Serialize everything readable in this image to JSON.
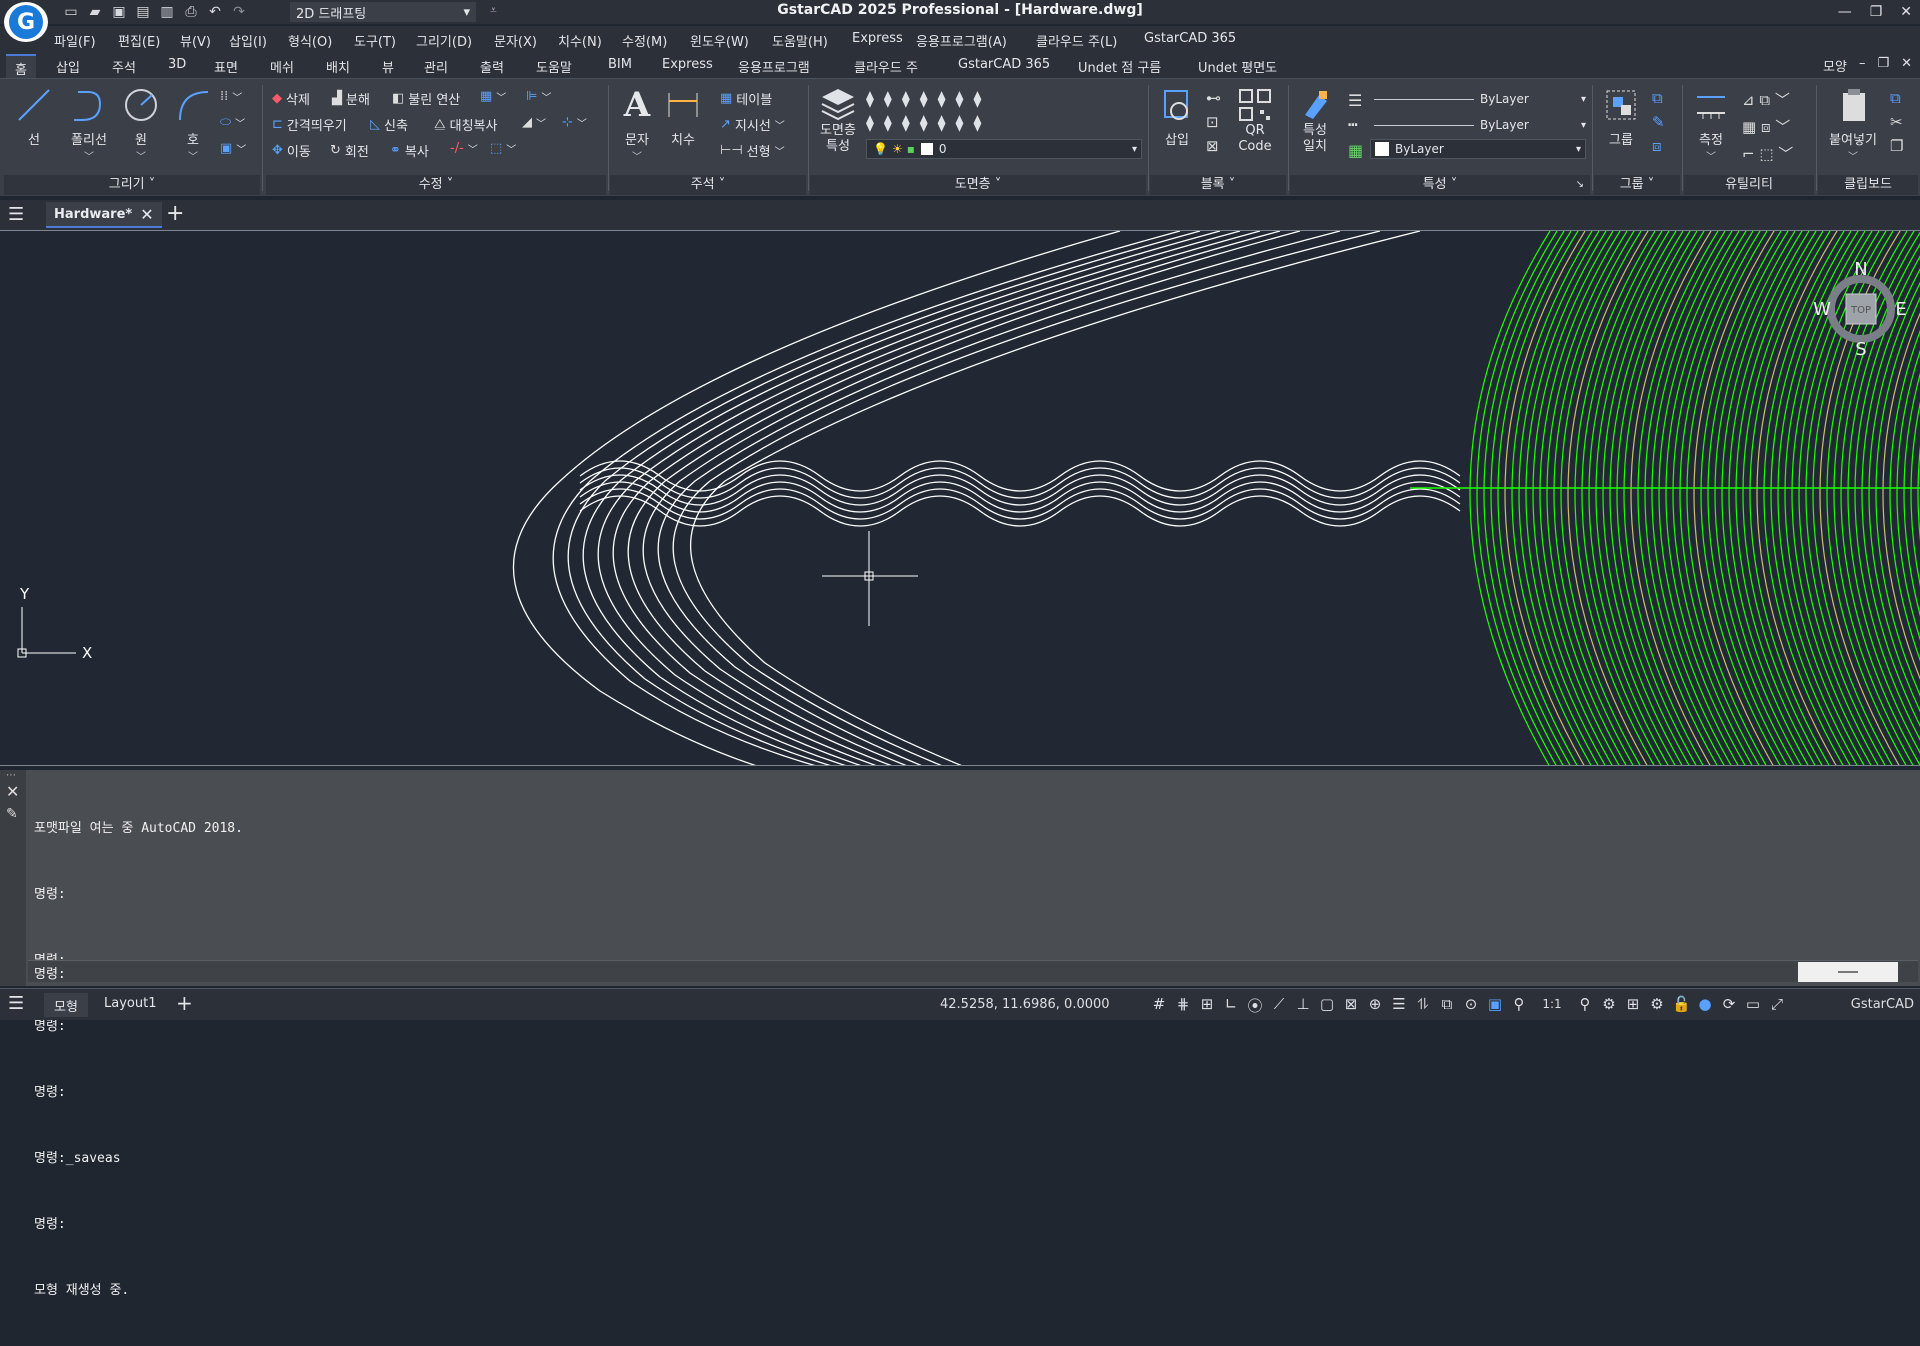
{
  "app": {
    "title": "GstarCAD 2025 Professional - [Hardware.dwg]",
    "logo_letter": "G",
    "workspace": "2D 드래프팅"
  },
  "menu": [
    "파일(F)",
    "편집(E)",
    "뷰(V)",
    "삽입(I)",
    "형식(O)",
    "도구(T)",
    "그리기(D)",
    "문자(X)",
    "치수(N)",
    "수정(M)",
    "윈도우(W)",
    "도움말(H)",
    "Express",
    "응용프로그램(A)",
    "클라우드 주(L)",
    "GstarCAD 365"
  ],
  "ribbon_tabs": [
    "홈",
    "삽입",
    "주석",
    "3D",
    "표면",
    "메쉬",
    "배치",
    "뷰",
    "관리",
    "출력",
    "도움말",
    "BIM",
    "Express",
    "응용프로그램",
    "클라우드 주",
    "GstarCAD 365",
    "Undet 점 구름",
    "Undet 평면도"
  ],
  "ribbon_right": "모양",
  "panels": {
    "draw": {
      "title": "그리기",
      "line": "선",
      "polyline": "폴리선",
      "circle": "원",
      "arc": "호"
    },
    "modify": {
      "title": "수정",
      "erase": "삭제",
      "explode": "분해",
      "boolean": "불린 연산",
      "offset": "간격띄우기",
      "stretch": "신축",
      "mirror": "대칭복사",
      "move": "이동",
      "rotate": "회전",
      "copy": "복사"
    },
    "annotation": {
      "title": "주석",
      "text": "문자",
      "dimension": "치수",
      "table": "테이블",
      "leader": "지시선",
      "linear": "선형"
    },
    "layers": {
      "title": "도면층",
      "properties": "도면층\n특성",
      "current_layer": "0"
    },
    "block": {
      "title": "블록",
      "insert": "삽입",
      "qr": "QR\nCode"
    },
    "properties": {
      "title": "특성",
      "match": "특성\n일치",
      "linetype": "ByLayer",
      "lineweight": "ByLayer",
      "color": "ByLayer"
    },
    "group": {
      "title": "그룹",
      "group": "그룹"
    },
    "utilities": {
      "title": "유틸리티",
      "measure": "측정"
    },
    "clipboard": {
      "title": "클립보드",
      "paste": "붙여넣기"
    }
  },
  "document_tab": "Hardware*",
  "viewcube": {
    "n": "N",
    "s": "S",
    "e": "E",
    "w": "W",
    "face": "TOP"
  },
  "ucs": {
    "x": "X",
    "y": "Y"
  },
  "command_history": [
    "포맷파일 여는 중 AutoCAD 2018.",
    "명령:",
    "명령:",
    "명령:",
    "명령:",
    "명령:_saveas",
    "명령:",
    "모형 재생성 중."
  ],
  "command_prompt": "명령:",
  "status": {
    "model_tab": "모형",
    "layout_tab": "Layout1",
    "coordinates": "42.5258, 11.6986, 0.0000",
    "annotation_scale": "1:1",
    "product": "GstarCAD"
  },
  "colors": {
    "accent": "#4c7bd6",
    "canvas": "#212833",
    "green_geometry": "#1cff00",
    "white_geometry": "#ffffff"
  }
}
